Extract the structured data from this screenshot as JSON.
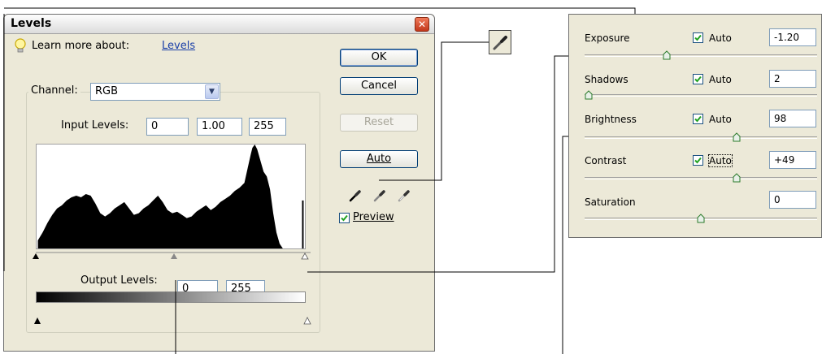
{
  "levels_dialog": {
    "title": "Levels",
    "close_glyph": "✕",
    "learn_more_label": "Learn more about:",
    "learn_more_link": "Levels",
    "buttons": {
      "ok": "OK",
      "cancel": "Cancel",
      "reset": "Reset",
      "auto": "Auto"
    },
    "channel": {
      "label": "Channel:",
      "value": "RGB"
    },
    "input_levels": {
      "label": "Input Levels:",
      "black": "0",
      "gamma": "1.00",
      "white": "255"
    },
    "output_levels": {
      "label": "Output Levels:",
      "black": "0",
      "white": "255"
    },
    "preview": {
      "label": "Preview",
      "checked": true
    },
    "icons": [
      "lightbulb-icon",
      "black-eyedropper-icon",
      "gray-eyedropper-icon",
      "white-eyedropper-icon",
      "close-icon"
    ]
  },
  "adjustments": [
    {
      "label": "Exposure",
      "auto_label": "Auto",
      "auto_checked": true,
      "value": "-1.20",
      "slider_level": 0.36
    },
    {
      "label": "Shadows",
      "auto_label": "Auto",
      "auto_checked": true,
      "value": "2",
      "slider_level": 0.02
    },
    {
      "label": "Brightness",
      "auto_label": "Auto",
      "auto_checked": true,
      "value": "98",
      "slider_level": 0.66
    },
    {
      "label": "Contrast",
      "auto_label": "Auto",
      "auto_checked": true,
      "value": "+49",
      "slider_level": 0.66
    },
    {
      "label": "Saturation",
      "value": "0",
      "slider_level": 0.5
    }
  ],
  "colors": {
    "dialog_bg": "#ece9d8",
    "button_border": "#003c74",
    "link": "#1a3fa8",
    "close_button": "#c2371b",
    "checkmark": "#21a121"
  }
}
